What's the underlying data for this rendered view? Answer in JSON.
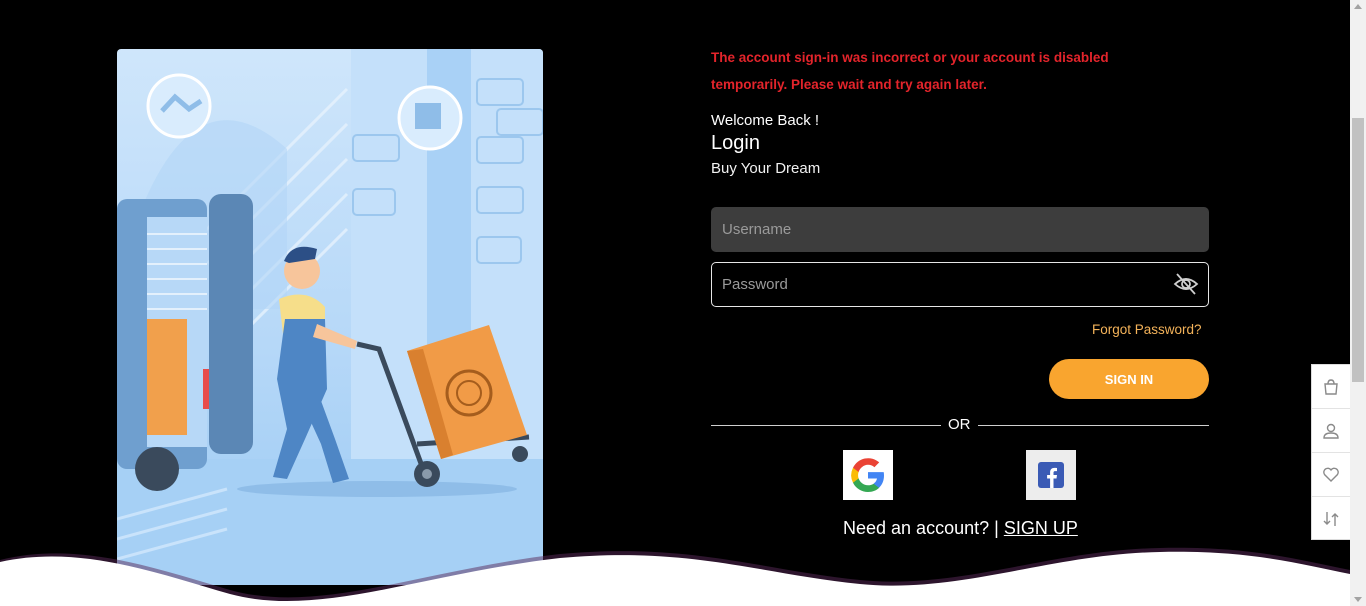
{
  "error_message": "The account sign-in was incorrect or your account is disabled temporarily. Please wait and try again later.",
  "login": {
    "welcome": "Welcome Back !",
    "title": "Login",
    "tagline": "Buy Your Dream",
    "username_placeholder": "Username",
    "password_placeholder": "Password",
    "username_value": "",
    "password_value": "",
    "forgot_label": "Forgot Password?",
    "signin_label": "SIGN IN",
    "or_label": "OR",
    "signup_prompt": "Need an account? |",
    "signup_label": "SIGN UP"
  },
  "social": {
    "google_icon": "google-logo",
    "facebook_icon": "facebook-logo"
  },
  "side_dock": [
    {
      "icon": "shopping-bag-icon"
    },
    {
      "icon": "user-icon"
    },
    {
      "icon": "heart-icon"
    },
    {
      "icon": "compare-icon"
    }
  ],
  "colors": {
    "background": "#000000",
    "error": "#e3242b",
    "accent": "#f9a52f",
    "forgot_link": "#f4b35a",
    "username_field_bg": "#3d3d3d"
  }
}
